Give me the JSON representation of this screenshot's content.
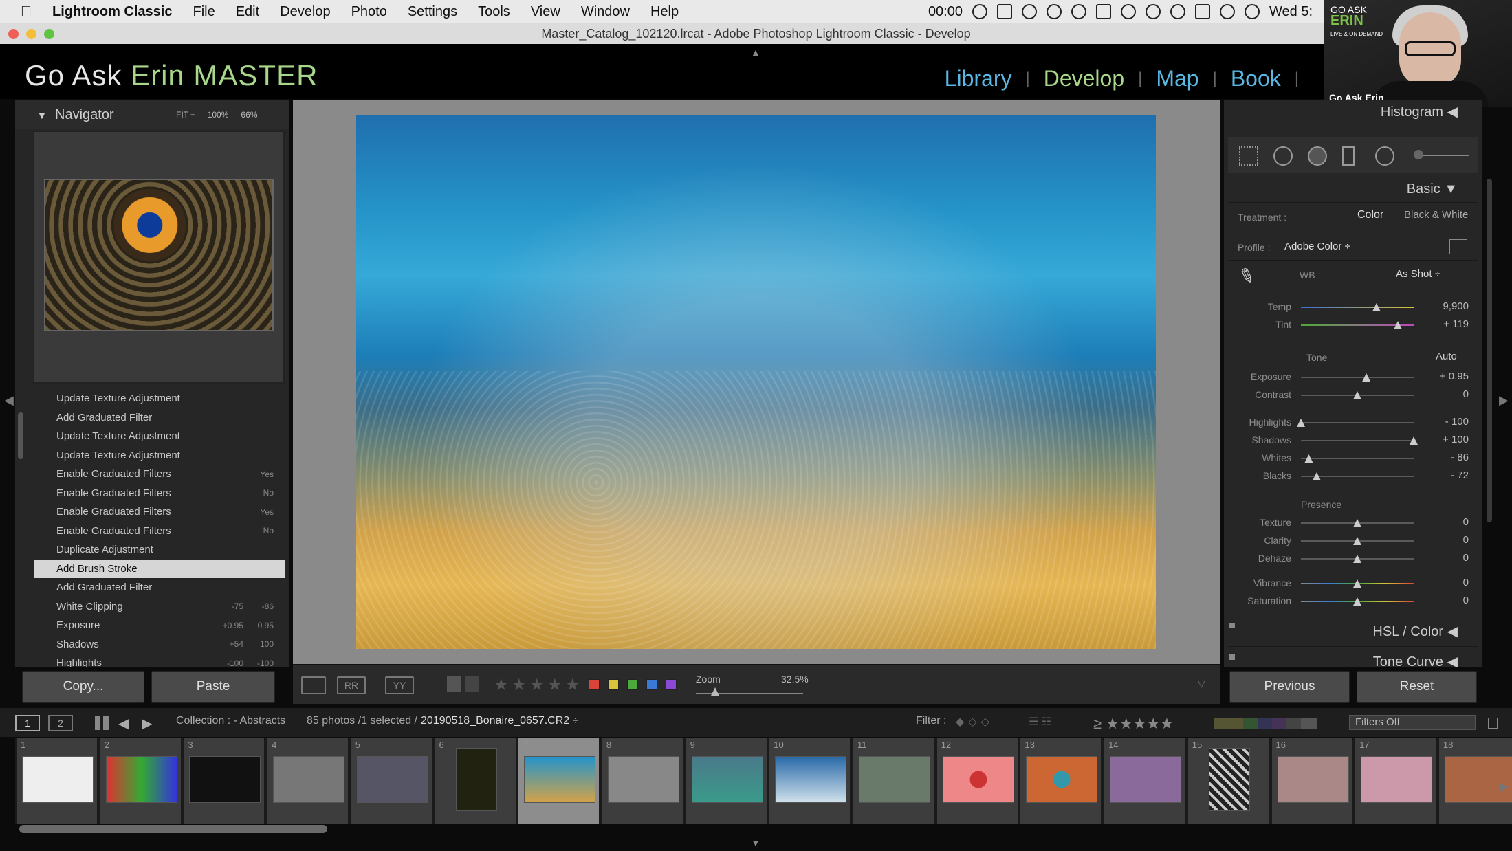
{
  "menubar": {
    "app": "Lightroom Classic",
    "items": [
      "File",
      "Edit",
      "Develop",
      "Photo",
      "Settings",
      "Tools",
      "View",
      "Window",
      "Help"
    ],
    "clock": "00:00",
    "date": "Wed 5:"
  },
  "window": {
    "title": "Master_Catalog_102120.lrcat - Adobe Photoshop Lightroom Classic - Develop"
  },
  "identity": {
    "logo_part1": "Go Ask ",
    "logo_part2": "Erin MASTER"
  },
  "modules": [
    {
      "label": "Library",
      "active": false
    },
    {
      "label": "Develop",
      "active": true
    },
    {
      "label": "Map",
      "active": false
    },
    {
      "label": "Book",
      "active": false
    }
  ],
  "webcam": {
    "brand_line1": "GO ASK",
    "brand_line2": "ERIN",
    "brand_line3": "LIVE & ON DEMAND",
    "name": "Go Ask Erin"
  },
  "navigator": {
    "title": "Navigator",
    "zoom_options": [
      "FIT ÷",
      "100%",
      "66%"
    ]
  },
  "history": [
    {
      "label": "Update Texture Adjustment",
      "v1": "",
      "v2": ""
    },
    {
      "label": "Add Graduated Filter",
      "v1": "",
      "v2": ""
    },
    {
      "label": "Update Texture Adjustment",
      "v1": "",
      "v2": ""
    },
    {
      "label": "Update Texture Adjustment",
      "v1": "",
      "v2": ""
    },
    {
      "label": "Enable Graduated Filters",
      "v1": "",
      "v2": "Yes"
    },
    {
      "label": "Enable Graduated Filters",
      "v1": "",
      "v2": "No"
    },
    {
      "label": "Enable Graduated Filters",
      "v1": "",
      "v2": "Yes"
    },
    {
      "label": "Enable Graduated Filters",
      "v1": "",
      "v2": "No"
    },
    {
      "label": "Duplicate Adjustment",
      "v1": "",
      "v2": ""
    },
    {
      "label": "Add Brush Stroke",
      "v1": "",
      "v2": "",
      "selected": true
    },
    {
      "label": "Add Graduated Filter",
      "v1": "",
      "v2": ""
    },
    {
      "label": "White Clipping",
      "v1": "-75",
      "v2": "-86"
    },
    {
      "label": "Exposure",
      "v1": "+0.95",
      "v2": "0.95"
    },
    {
      "label": "Shadows",
      "v1": "+54",
      "v2": "100"
    },
    {
      "label": "Highlights",
      "v1": "-100",
      "v2": "-100"
    }
  ],
  "left_buttons": {
    "copy": "Copy...",
    "paste": "Paste"
  },
  "toolbar": {
    "zoom_label": "Zoom",
    "zoom_value": "32.5%"
  },
  "right_panel": {
    "histogram": "Histogram",
    "basic": "Basic",
    "treatment_label": "Treatment :",
    "treatment_color": "Color",
    "treatment_bw": "Black & White",
    "profile_label": "Profile :",
    "profile_value": "Adobe Color ÷",
    "wb_label": "WB :",
    "wb_value": "As Shot ÷",
    "tone_label": "Tone",
    "auto_label": "Auto",
    "presence_label": "Presence",
    "hsl_label": "HSL / Color",
    "tone_curve_label": "Tone Curve",
    "previous": "Previous",
    "reset": "Reset",
    "sliders": [
      {
        "label": "Temp",
        "value": "9,900",
        "pos": 0.67
      },
      {
        "label": "Tint",
        "value": "+ 119",
        "pos": 0.86
      },
      {
        "label": "Exposure",
        "value": "+ 0.95",
        "pos": 0.58
      },
      {
        "label": "Contrast",
        "value": "0",
        "pos": 0.5
      },
      {
        "label": "Highlights",
        "value": "- 100",
        "pos": 0.0
      },
      {
        "label": "Shadows",
        "value": "+ 100",
        "pos": 1.0
      },
      {
        "label": "Whites",
        "value": "- 86",
        "pos": 0.07
      },
      {
        "label": "Blacks",
        "value": "- 72",
        "pos": 0.14
      },
      {
        "label": "Texture",
        "value": "0",
        "pos": 0.5
      },
      {
        "label": "Clarity",
        "value": "0",
        "pos": 0.5
      },
      {
        "label": "Dehaze",
        "value": "0",
        "pos": 0.5
      },
      {
        "label": "Vibrance",
        "value": "0",
        "pos": 0.5
      },
      {
        "label": "Saturation",
        "value": "0",
        "pos": 0.5
      }
    ]
  },
  "filmbar": {
    "collection": "Collection : - Abstracts",
    "count": "85 photos /1 selected /",
    "filename": "20190518_Bonaire_0657.CR2 ÷",
    "filter_label": "Filter :",
    "filter_value": "Filters Off",
    "page1": "1",
    "page2": "2"
  },
  "filmstrip": [
    "1",
    "2",
    "3",
    "4",
    "5",
    "6",
    "7",
    "8",
    "9",
    "10",
    "11",
    "12",
    "13",
    "14",
    "15",
    "16",
    "17",
    "18"
  ],
  "colors": {
    "accent_green": "#a8d68a",
    "module_blue": "#59b7e3"
  }
}
